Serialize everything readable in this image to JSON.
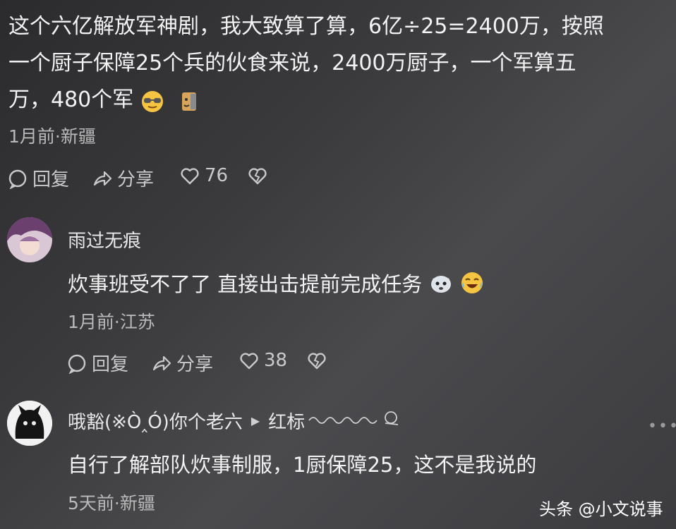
{
  "top_comment": {
    "line1": "这个六亿解放军神剧，我大致算了算，6亿÷25=2400万，按照",
    "line2": "一个厨子保障25个兵的伙食来说，2400万厨子，一个军算五",
    "line3": "万，480个军",
    "meta": "1月前·新疆",
    "reply": "回复",
    "share": "分享",
    "likes": "76"
  },
  "comment2": {
    "username": "雨过无痕",
    "text": "炊事班受不了了 直接出击提前完成任务",
    "meta": "1月前·江苏",
    "reply": "回复",
    "share": "分享",
    "likes": "38"
  },
  "comment3": {
    "username": "哦豁(※Ò‸Ó)你个老六",
    "reply_target": "红标",
    "text": "自行了解部队炊事制服，1厨保障25，这不是我说的",
    "meta": "5天前·新疆"
  },
  "watermark": "头条 @小文说事"
}
